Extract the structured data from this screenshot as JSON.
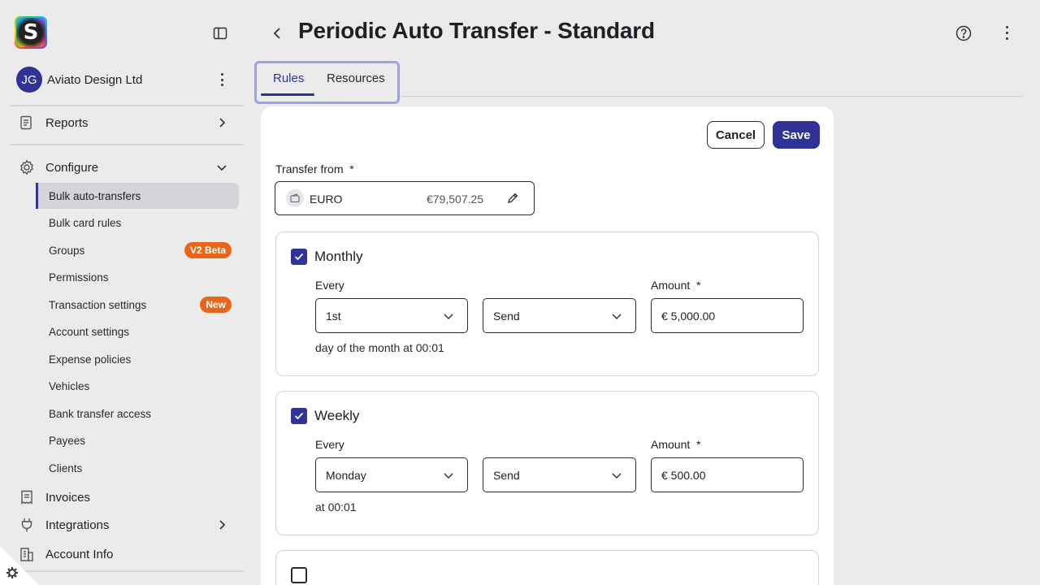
{
  "app": {
    "logo_letter": "S",
    "accent_color": "#2f3296",
    "badge_color": "#e8651a"
  },
  "sidebar": {
    "account": {
      "initials": "JG",
      "name": "Aviato Design Ltd"
    },
    "reports": "Reports",
    "configure": "Configure",
    "configure_items": [
      {
        "label": "Bulk auto-transfers",
        "active": true
      },
      {
        "label": "Bulk card rules"
      },
      {
        "label": "Groups",
        "badge": "V2 Beta"
      },
      {
        "label": "Permissions"
      },
      {
        "label": "Transaction settings",
        "badge": "New"
      },
      {
        "label": "Account settings"
      },
      {
        "label": "Expense policies"
      },
      {
        "label": "Vehicles"
      },
      {
        "label": "Bank transfer access"
      },
      {
        "label": "Payees"
      },
      {
        "label": "Clients"
      }
    ],
    "invoices": "Invoices",
    "integrations": "Integrations",
    "account_info": "Account Info"
  },
  "header": {
    "title": "Periodic Auto Transfer - Standard"
  },
  "tabs": [
    {
      "label": "Rules",
      "active": true
    },
    {
      "label": "Resources"
    }
  ],
  "form": {
    "cancel_label": "Cancel",
    "save_label": "Save",
    "transfer_from_label": "Transfer from",
    "required_mark": "*",
    "source": {
      "name": "EURO",
      "balance": "€79,507.25"
    },
    "rules": [
      {
        "title": "Monthly",
        "checked": true,
        "every_label": "Every",
        "every_value": "1st",
        "action_value": "Send",
        "amount_label": "Amount",
        "amount_value": "€ 5,000.00",
        "hint": "day of the month at 00:01"
      },
      {
        "title": "Weekly",
        "checked": true,
        "every_label": "Every",
        "every_value": "Monday",
        "action_value": "Send",
        "amount_label": "Amount",
        "amount_value": "€ 500.00",
        "hint": "at 00:01"
      }
    ]
  }
}
